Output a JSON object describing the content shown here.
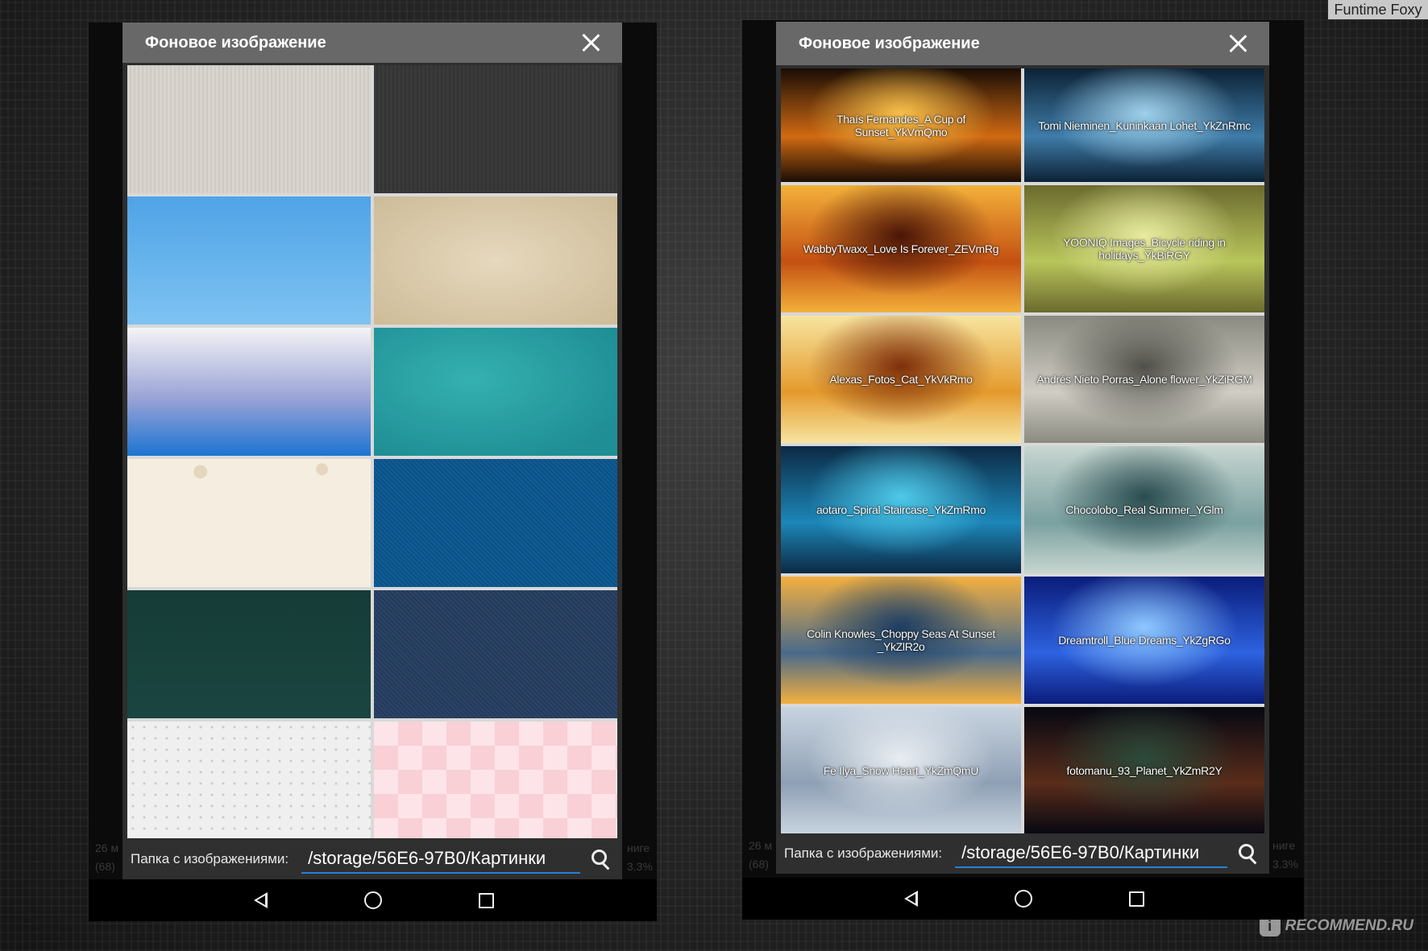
{
  "watermarks": {
    "top": "Funtime Foxy",
    "bottom": "RECOMMEND.RU"
  },
  "icons": [
    "close-icon",
    "search-icon",
    "nav-back-icon",
    "nav-home-icon",
    "nav-recent-icon"
  ],
  "left_dialog": {
    "title": "Фоновое изображение",
    "folder_label": "Папка с изображениями:",
    "folder_path": "/storage/56E6-97B0/Картинки",
    "side_text": [
      "26 м",
      "(68)",
      "ниге",
      "3.3%"
    ],
    "tiles": [
      {
        "style": "light-stripes",
        "colors": [
          "#d8d4ce",
          "#cfcac3"
        ]
      },
      {
        "style": "dark-stripes",
        "colors": [
          "#3a3a3a",
          "#333333"
        ]
      },
      {
        "style": "sky-blue",
        "colors": [
          "#4fa3e6",
          "#7ec3f2"
        ]
      },
      {
        "style": "parchment",
        "colors": [
          "#cdbb98",
          "#e6d8bd"
        ]
      },
      {
        "style": "winter-gradient",
        "colors": [
          "#f4f4f6",
          "#9aa3d6",
          "#1d74d2"
        ]
      },
      {
        "style": "teal-water",
        "colors": [
          "#1f8f95",
          "#35b0b0"
        ]
      },
      {
        "style": "cream-floral",
        "colors": [
          "#f5eee0",
          "#efe4cf"
        ]
      },
      {
        "style": "blue-denim",
        "colors": [
          "#0f4f84",
          "#0d5e96"
        ]
      },
      {
        "style": "dark-green",
        "colors": [
          "#163c37",
          "#1a4540"
        ]
      },
      {
        "style": "navy-fabric",
        "colors": [
          "#243a5a",
          "#2b4466"
        ]
      },
      {
        "style": "white-dots",
        "colors": [
          "#efefef",
          "#e2e2e2"
        ]
      },
      {
        "style": "pink-check",
        "colors": [
          "#f8d0d6",
          "#fde4e8"
        ]
      }
    ]
  },
  "right_dialog": {
    "title": "Фоновое изображение",
    "folder_label": "Папка с изображениями:",
    "folder_path": "/storage/56E6-97B0/Картинки",
    "side_text": [
      "26 м",
      "(68)",
      "ниге",
      "3.3%"
    ],
    "tiles": [
      {
        "label": "Thaís Fernandes_A Cup of Sunset_YkVmQmo",
        "colors": [
          "#1a0d05",
          "#d06a12",
          "#f7c04a"
        ]
      },
      {
        "label": "Tomi Nieminen_Kuninkaan Lohet_YkZnRmc",
        "colors": [
          "#0c2236",
          "#3f7ca8",
          "#9fd0ea"
        ]
      },
      {
        "label": "WabbyTwaxx_Love Is Forever_ZEVmRg",
        "colors": [
          "#f3b13a",
          "#c45012",
          "#4a1607"
        ]
      },
      {
        "label": "YOONIQ Images_Bicycle riding in holidays_YkBiRGY",
        "colors": [
          "#6b6a2e",
          "#b8c55a",
          "#e8eba0"
        ]
      },
      {
        "label": "Alexas_Fotos_Cat_YkVkRmo",
        "colors": [
          "#f7e4a0",
          "#e49a2c",
          "#7e2e0a"
        ]
      },
      {
        "label": "Andrés Nieto Porras_Alone flower_YkZiRGM",
        "colors": [
          "#8a8a80",
          "#d0cdc4",
          "#50504a"
        ]
      },
      {
        "label": "aotaro_Spiral Staircase_YkZmRmo",
        "colors": [
          "#0c2a44",
          "#1c86b8",
          "#4ec8e8"
        ]
      },
      {
        "label": "Chocolobo_Real Summer_YGlm",
        "colors": [
          "#c7d6d0",
          "#7aa0a0",
          "#2a4c50"
        ]
      },
      {
        "label": "Colin Knowles_Choppy Seas At Sunset _YkZlR2o",
        "colors": [
          "#f4b040",
          "#4a6a8a",
          "#1d3e62"
        ]
      },
      {
        "label": "Dreamtroll_Blue Dreams_YkZgRGo",
        "colors": [
          "#0a1c7a",
          "#2e62e0",
          "#8ec8ff"
        ]
      },
      {
        "label": "Fe Ilya_Snow Heart_YkZmQmU",
        "colors": [
          "#c8d4e0",
          "#8fa0b4",
          "#e9edf2"
        ]
      },
      {
        "label": "fotomanu_93_Planet_YkZmR2Y",
        "colors": [
          "#060812",
          "#5a2c1a",
          "#2b4a3a"
        ]
      }
    ]
  }
}
